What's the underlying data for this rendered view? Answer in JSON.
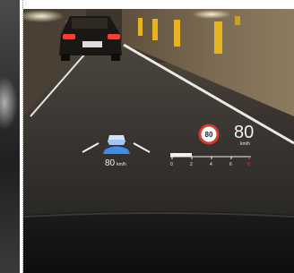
{
  "hud": {
    "current_speed": "80",
    "current_speed_unit": "km/h",
    "set_speed": "80",
    "set_speed_unit": "km/h",
    "speed_limit": "80",
    "gauge_ticks": [
      "0",
      "2",
      "4",
      "6",
      "8"
    ]
  },
  "colors": {
    "hud_blue": "#3c8ee8",
    "speed_limit_ring": "#d93a2f",
    "gauge_red": "#e03a32",
    "bollard_yellow": "#e6b422"
  },
  "icons": [
    "lane-assist-icon",
    "speed-limit-sign-icon"
  ]
}
